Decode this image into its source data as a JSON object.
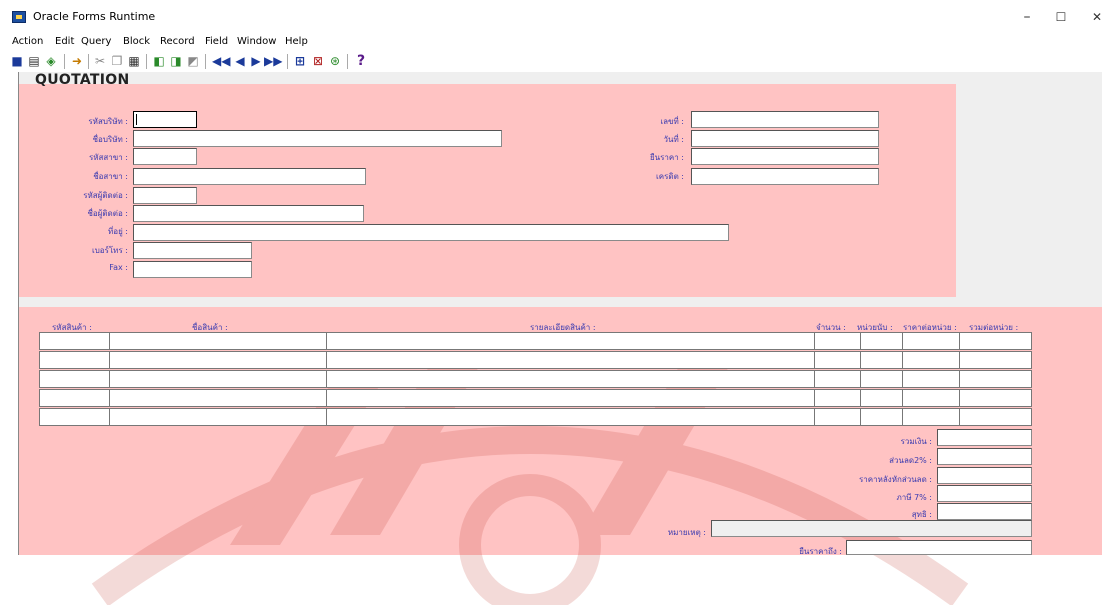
{
  "window": {
    "title": "Oracle Forms Runtime",
    "minimize": "–",
    "maximize": "☐",
    "close": "✕"
  },
  "menu": [
    "Action",
    "Edit",
    "Query",
    "Block",
    "Record",
    "Field",
    "Window",
    "Help"
  ],
  "toolbar": {
    "help_glyph": "?"
  },
  "form": {
    "heading": "QUOTATION",
    "left_fields": [
      {
        "label": "รหัสบริษัท :",
        "value": ""
      },
      {
        "label": "ชื่อบริษัท :",
        "value": ""
      },
      {
        "label": "รหัสสาขา :",
        "value": ""
      },
      {
        "label": "ชื่อสาขา :",
        "value": ""
      },
      {
        "label": "รหัสผู้ติดต่อ :",
        "value": ""
      },
      {
        "label": "ชื่อผู้ติดต่อ :",
        "value": ""
      },
      {
        "label": "ที่อยู่ :",
        "value": ""
      },
      {
        "label": "เบอร์โทร :",
        "value": ""
      },
      {
        "label": "Fax :",
        "value": ""
      }
    ],
    "right_fields": [
      {
        "label": "เลขที่ :",
        "value": ""
      },
      {
        "label": "วันที่ :",
        "value": ""
      },
      {
        "label": "ยืนราคา :",
        "value": ""
      },
      {
        "label": "เครดิต :",
        "value": ""
      }
    ]
  },
  "detail": {
    "columns": [
      "รหัสสินค้า :",
      "ชื่อสินค้า :",
      "รายละเอียดสินค้า :",
      "จำนวน :",
      "หน่วยนับ :",
      "ราคาต่อหน่วย :",
      "รวมต่อหน่วย :"
    ],
    "rows": [
      [
        "",
        "",
        "",
        "",
        "",
        "",
        ""
      ],
      [
        "",
        "",
        "",
        "",
        "",
        "",
        ""
      ],
      [
        "",
        "",
        "",
        "",
        "",
        "",
        ""
      ],
      [
        "",
        "",
        "",
        "",
        "",
        "",
        ""
      ]
    ],
    "totals": [
      {
        "label": "รวมเงิน :",
        "value": ""
      },
      {
        "label": "ส่วนลด2% :",
        "value": ""
      },
      {
        "label": "ราคาหลังหักส่วนลด :",
        "value": ""
      },
      {
        "label": "ภาษี 7% :",
        "value": ""
      },
      {
        "label": "สุทธิ :",
        "value": ""
      }
    ],
    "remark": {
      "label": "หมายเหตุ :",
      "value": ""
    },
    "valid": {
      "label": "ยืนราคาถึง :",
      "value": ""
    }
  }
}
